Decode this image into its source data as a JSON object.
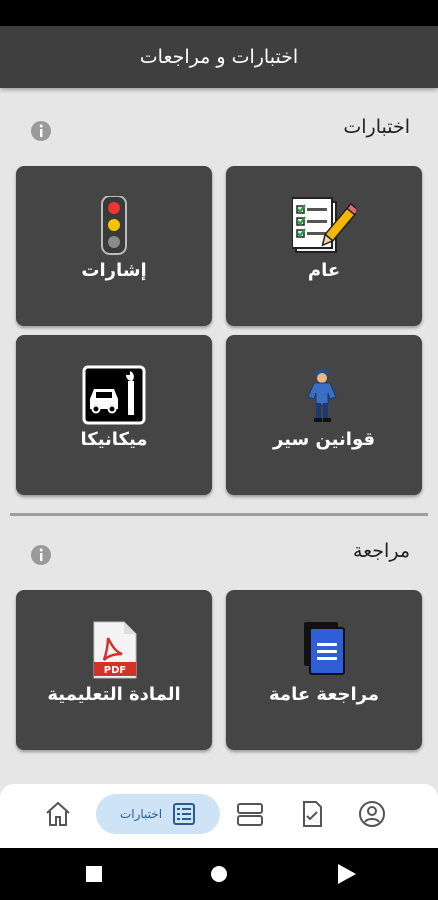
{
  "appbar": {
    "title": "اختبارات و مراجعات"
  },
  "sections": [
    {
      "title": "اختبارات",
      "info_icon": "info-icon",
      "tiles": [
        {
          "label": "عام",
          "icon": "checklist-pencil-icon"
        },
        {
          "label": "إشارات",
          "icon": "traffic-light-icon"
        },
        {
          "label": "قوانين سير",
          "icon": "traffic-officer-icon"
        },
        {
          "label": "ميكانيكا",
          "icon": "car-wrench-icon"
        }
      ]
    },
    {
      "title": "مراجعة",
      "info_icon": "info-icon",
      "tiles": [
        {
          "label": "مراجعة عامة",
          "icon": "documents-icon"
        },
        {
          "label": "المادة التعليمية",
          "icon": "pdf-icon"
        }
      ]
    }
  ],
  "bottom_nav": {
    "items": [
      {
        "icon": "home-icon"
      },
      {
        "icon": "list-icon",
        "label": "اختبارات",
        "active": true
      },
      {
        "icon": "layers-icon"
      },
      {
        "icon": "document-check-icon"
      },
      {
        "icon": "account-icon"
      }
    ]
  },
  "system_nav": {
    "items": [
      "recents-icon",
      "home-circle-icon",
      "back-icon"
    ]
  },
  "colors": {
    "tile_bg": "#454545",
    "appbar_bg": "#3f3f3f",
    "page_bg": "#e6e6e6",
    "active_pill": "#cfe3f6"
  }
}
